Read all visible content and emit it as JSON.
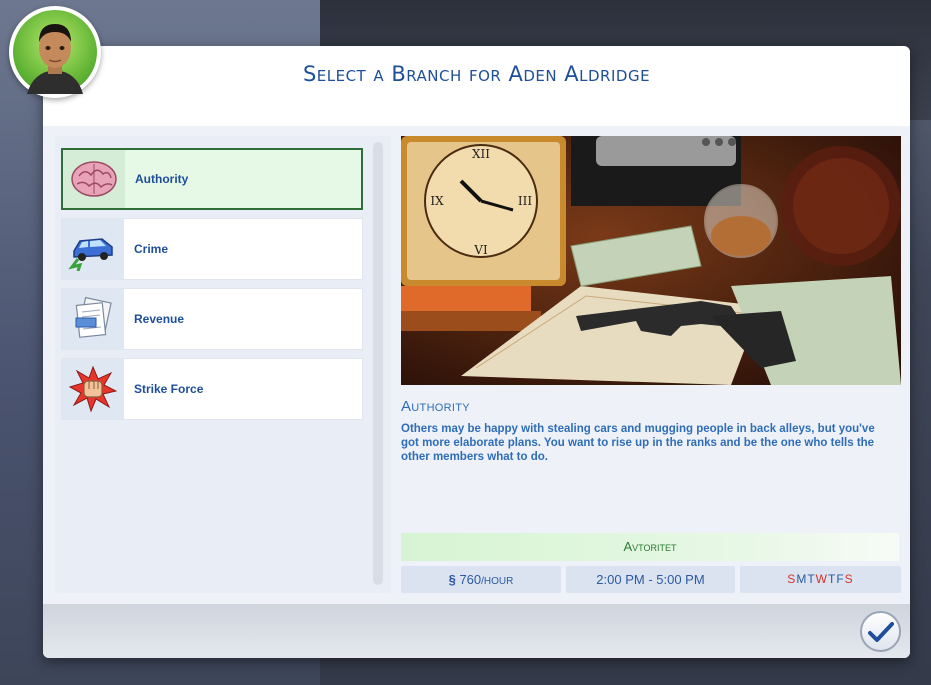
{
  "dialog": {
    "title": "Select a Branch for Aden Aldridge"
  },
  "branches": [
    {
      "label": "Authority",
      "icon": "brain-icon",
      "selected": true
    },
    {
      "label": "Crime",
      "icon": "stolen-car-icon",
      "selected": false
    },
    {
      "label": "Revenue",
      "icon": "documents-icon",
      "selected": false
    },
    {
      "label": "Strike Force",
      "icon": "fist-icon",
      "selected": false
    }
  ],
  "detail": {
    "name": "Authority",
    "description": "Others may be happy with stealing cars and mugging people in back alleys, but you've got more elaborate plans. You want to rise up in the ranks and be the one who tells the other members what to do.",
    "job_title": "Avtoritet",
    "pay_amount": "760",
    "pay_unit": "/HOUR",
    "hours": "2:00  PM - 5:00  PM",
    "days": [
      {
        "letter": "S",
        "active": true
      },
      {
        "letter": "M",
        "active": false
      },
      {
        "letter": "T",
        "active": false
      },
      {
        "letter": "W",
        "active": true
      },
      {
        "letter": "T",
        "active": false
      },
      {
        "letter": "F",
        "active": false
      },
      {
        "letter": "S",
        "active": true
      }
    ]
  },
  "colors": {
    "accent": "#1f4e9a",
    "selected_border": "#2f6e39",
    "active_day": "#d8332a"
  }
}
